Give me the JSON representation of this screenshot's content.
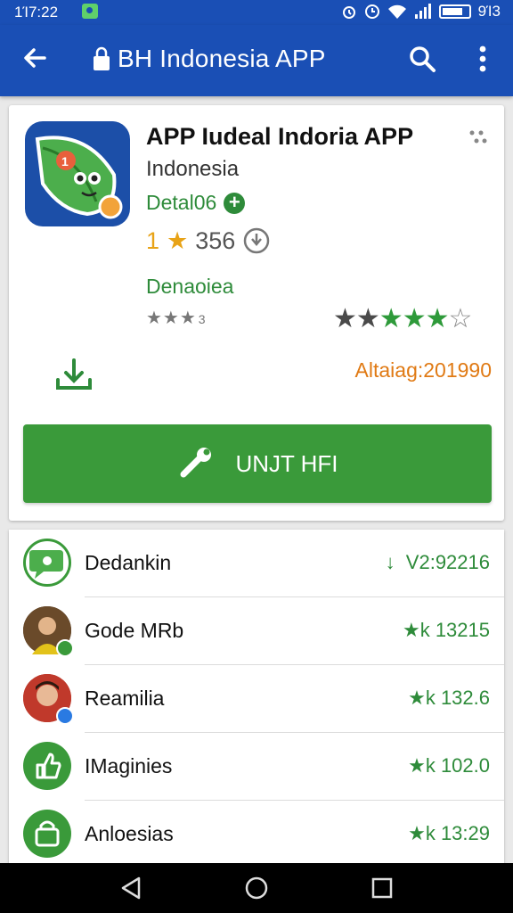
{
  "status_bar": {
    "time": "1Ί7:22",
    "battery": "9Ί3"
  },
  "app_bar": {
    "title": "BH Indonesia APP",
    "icons": [
      "back-arrow-icon",
      "lock-icon",
      "search-icon",
      "more-vert-icon"
    ]
  },
  "app": {
    "name": "APP Iudeal Indoria APP",
    "developer": "Indonesia",
    "detail_label": "Detal06",
    "rating_value": "1",
    "rating_count": "356",
    "category": "Denaoiea",
    "small_stars_count": "3",
    "updated": "Altaiag:201990",
    "install_label": "UNJT HFI"
  },
  "list": [
    {
      "name": "Dedankin",
      "value": "V2:92216",
      "prefix": "↓"
    },
    {
      "name": "Gode MRb",
      "value": "★k 13215",
      "prefix": ""
    },
    {
      "name": "Reamilia",
      "value": "★k 132.6",
      "prefix": ""
    },
    {
      "name": "IMaginies",
      "value": "★k 102.0",
      "prefix": ""
    },
    {
      "name": "Anloesias",
      "value": "★k 13:29",
      "prefix": ""
    }
  ],
  "colors": {
    "primary": "#1a4fb5",
    "accent_green": "#3a9a3a",
    "updated_orange": "#e07a14"
  }
}
